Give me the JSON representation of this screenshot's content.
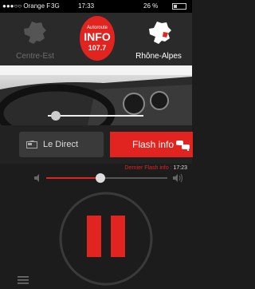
{
  "status_bar": {
    "carrier": "●●●○○ Orange F",
    "network": "3G",
    "time": "17:33",
    "battery": "26 %"
  },
  "regions": {
    "left": "Centre-Est",
    "right": "Rhône-Alpes"
  },
  "logo": {
    "line1": "Autoroute",
    "line2": "INFO",
    "line3": "107.7"
  },
  "tabs": {
    "direct": "Le Direct",
    "flash": "Flash info"
  },
  "last_flash": {
    "label": "Dernier Flash info :",
    "time": "17:23"
  },
  "volume": {
    "level": 0.45
  },
  "colors": {
    "accent": "#e1241f",
    "background": "#1c1c1c"
  },
  "icons": [
    "france-map-icon",
    "radio-icon",
    "car-crash-icon",
    "speaker-low-icon",
    "speaker-high-icon",
    "pause-icon",
    "menu-icon"
  ]
}
